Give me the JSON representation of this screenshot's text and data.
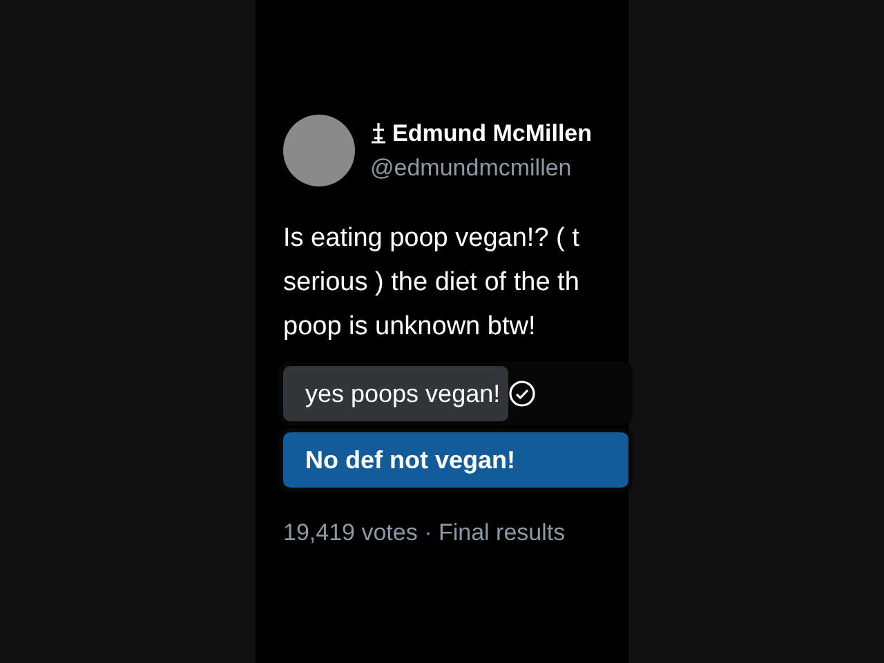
{
  "author": {
    "name": "Edmund McMillen",
    "handle": "@edmundmcmillen"
  },
  "text_lines": [
    "Is eating poop vegan!? ( t",
    "serious ) the diet of the th",
    "poop is unknown btw!"
  ],
  "poll": {
    "options": [
      {
        "label": "yes poops vegan!",
        "level": 0.65,
        "voted": true,
        "leading": false
      },
      {
        "label": "No def not vegan!",
        "level": 1,
        "voted": false,
        "leading": true
      }
    ],
    "footer": "19,419 votes · Final results"
  }
}
